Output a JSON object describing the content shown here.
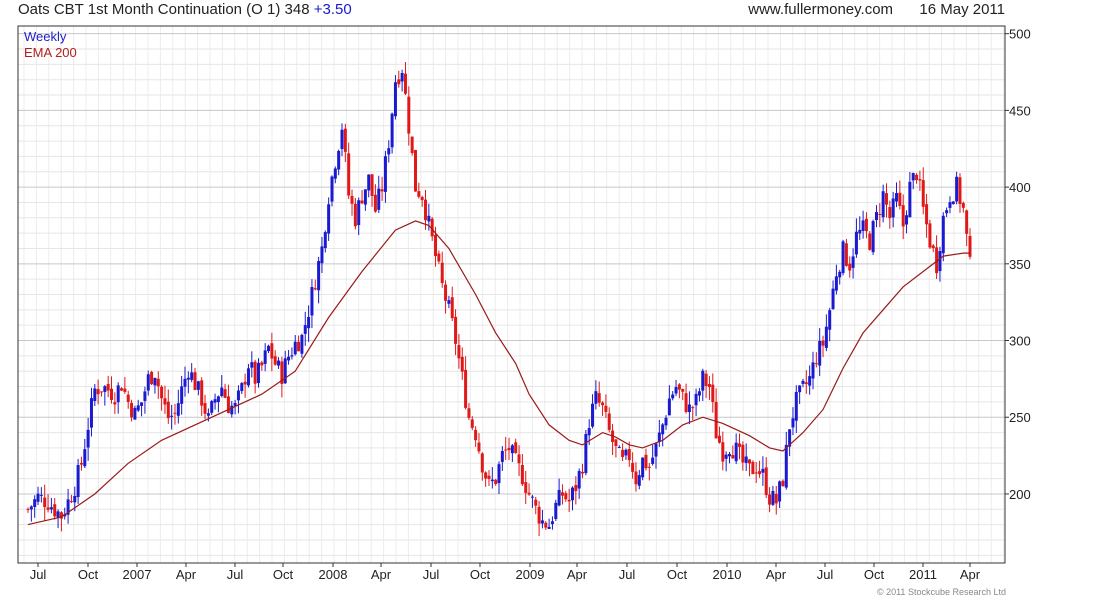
{
  "header": {
    "title": "Oats CBT 1st Month Continuation (O 1)",
    "last": "348",
    "change": "+3.50",
    "website": "www.fullermoney.com",
    "date": "16 May 2011"
  },
  "footer": {
    "copyright": "© 2011 Stockcube Research Ltd"
  },
  "colors": {
    "up": "#1a1ad0",
    "down": "#e01818",
    "ema": "#9a1a1a",
    "grid": "#d4d4d4",
    "frame": "#333333"
  },
  "chart_data": {
    "type": "candlestick",
    "title": "Oats CBT 1st Month Continuation (O 1)",
    "frequency": "Weekly",
    "indicator": "EMA 200",
    "legend": [
      "Weekly",
      "EMA 200"
    ],
    "legend_placement": "top-left",
    "y_axis_position": "right",
    "ylim": [
      155,
      505
    ],
    "yticks": [
      200,
      250,
      300,
      350,
      400,
      450,
      500
    ],
    "x_labels": [
      "Jul",
      "Oct",
      "2007",
      "Apr",
      "Jul",
      "Oct",
      "2008",
      "Apr",
      "Jul",
      "Oct",
      "2009",
      "Apr",
      "Jul",
      "Oct",
      "2010",
      "Apr",
      "Jul",
      "Oct",
      "2011",
      "Apr"
    ],
    "grid": true,
    "close_series": {
      "name": "Weekly",
      "points": [
        [
          0,
          190
        ],
        [
          3,
          198
        ],
        [
          6,
          195
        ],
        [
          8,
          190
        ],
        [
          10,
          186
        ],
        [
          12,
          195
        ],
        [
          14,
          205
        ],
        [
          16,
          220
        ],
        [
          18,
          245
        ],
        [
          20,
          268
        ],
        [
          22,
          270
        ],
        [
          24,
          268
        ],
        [
          26,
          265
        ],
        [
          28,
          272
        ],
        [
          30,
          260
        ],
        [
          32,
          252
        ],
        [
          34,
          260
        ],
        [
          36,
          275
        ],
        [
          38,
          280
        ],
        [
          40,
          262
        ],
        [
          42,
          250
        ],
        [
          44,
          252
        ],
        [
          46,
          268
        ],
        [
          48,
          282
        ],
        [
          50,
          272
        ],
        [
          52,
          262
        ],
        [
          54,
          248
        ],
        [
          56,
          262
        ],
        [
          58,
          270
        ],
        [
          60,
          258
        ],
        [
          62,
          256
        ],
        [
          64,
          268
        ],
        [
          66,
          285
        ],
        [
          68,
          275
        ],
        [
          70,
          283
        ],
        [
          72,
          295
        ],
        [
          74,
          285
        ],
        [
          76,
          278
        ],
        [
          78,
          290
        ],
        [
          80,
          298
        ],
        [
          82,
          302
        ],
        [
          84,
          320
        ],
        [
          86,
          340
        ],
        [
          88,
          360
        ],
        [
          90,
          395
        ],
        [
          92,
          418
        ],
        [
          94,
          440
        ],
        [
          96,
          395
        ],
        [
          98,
          380
        ],
        [
          100,
          395
        ],
        [
          102,
          405
        ],
        [
          104,
          385
        ],
        [
          106,
          400
        ],
        [
          108,
          430
        ],
        [
          110,
          470
        ],
        [
          112,
          478
        ],
        [
          114,
          440
        ],
        [
          116,
          400
        ],
        [
          118,
          395
        ],
        [
          120,
          375
        ],
        [
          122,
          355
        ],
        [
          124,
          335
        ],
        [
          126,
          320
        ],
        [
          128,
          300
        ],
        [
          130,
          275
        ],
        [
          132,
          250
        ],
        [
          134,
          240
        ],
        [
          136,
          220
        ],
        [
          138,
          205
        ],
        [
          140,
          210
        ],
        [
          142,
          225
        ],
        [
          144,
          230
        ],
        [
          146,
          220
        ],
        [
          148,
          212
        ],
        [
          150,
          200
        ],
        [
          152,
          190
        ],
        [
          154,
          182
        ],
        [
          156,
          180
        ],
        [
          158,
          192
        ],
        [
          160,
          200
        ],
        [
          162,
          195
        ],
        [
          164,
          205
        ],
        [
          166,
          220
        ],
        [
          168,
          248
        ],
        [
          170,
          262
        ],
        [
          172,
          255
        ],
        [
          174,
          240
        ],
        [
          176,
          228
        ],
        [
          178,
          220
        ],
        [
          180,
          225
        ],
        [
          182,
          210
        ],
        [
          184,
          222
        ],
        [
          186,
          218
        ],
        [
          188,
          230
        ],
        [
          190,
          245
        ],
        [
          192,
          262
        ],
        [
          194,
          270
        ],
        [
          196,
          262
        ],
        [
          198,
          255
        ],
        [
          200,
          260
        ],
        [
          202,
          275
        ],
        [
          204,
          270
        ],
        [
          206,
          240
        ],
        [
          208,
          228
        ],
        [
          210,
          232
        ],
        [
          212,
          228
        ],
        [
          214,
          220
        ],
        [
          216,
          215
        ],
        [
          218,
          218
        ],
        [
          220,
          212
        ],
        [
          222,
          198
        ],
        [
          224,
          195
        ],
        [
          226,
          210
        ],
        [
          228,
          245
        ],
        [
          230,
          260
        ],
        [
          232,
          268
        ],
        [
          234,
          275
        ],
        [
          236,
          290
        ],
        [
          238,
          298
        ],
        [
          240,
          320
        ],
        [
          242,
          345
        ],
        [
          244,
          358
        ],
        [
          246,
          350
        ],
        [
          248,
          368
        ],
        [
          250,
          372
        ],
        [
          252,
          365
        ],
        [
          254,
          380
        ],
        [
          256,
          395
        ],
        [
          258,
          380
        ],
        [
          260,
          392
        ],
        [
          262,
          375
        ],
        [
          264,
          400
        ],
        [
          266,
          410
        ],
        [
          268,
          385
        ],
        [
          270,
          365
        ],
        [
          272,
          350
        ],
        [
          274,
          380
        ],
        [
          276,
          395
        ],
        [
          278,
          400
        ],
        [
          280,
          385
        ],
        [
          282,
          348
        ]
      ]
    },
    "ema_series": {
      "name": "EMA 200",
      "points": [
        [
          0,
          180
        ],
        [
          10,
          185
        ],
        [
          20,
          200
        ],
        [
          30,
          220
        ],
        [
          40,
          235
        ],
        [
          50,
          245
        ],
        [
          60,
          255
        ],
        [
          70,
          265
        ],
        [
          80,
          280
        ],
        [
          90,
          315
        ],
        [
          100,
          345
        ],
        [
          110,
          372
        ],
        [
          116,
          378
        ],
        [
          120,
          375
        ],
        [
          126,
          360
        ],
        [
          134,
          330
        ],
        [
          140,
          305
        ],
        [
          146,
          285
        ],
        [
          150,
          265
        ],
        [
          156,
          245
        ],
        [
          162,
          235
        ],
        [
          166,
          232
        ],
        [
          172,
          240
        ],
        [
          176,
          237
        ],
        [
          180,
          232
        ],
        [
          184,
          230
        ],
        [
          190,
          235
        ],
        [
          196,
          245
        ],
        [
          202,
          250
        ],
        [
          208,
          246
        ],
        [
          216,
          238
        ],
        [
          222,
          230
        ],
        [
          226,
          228
        ],
        [
          232,
          240
        ],
        [
          238,
          255
        ],
        [
          244,
          282
        ],
        [
          250,
          305
        ],
        [
          256,
          320
        ],
        [
          262,
          335
        ],
        [
          268,
          345
        ],
        [
          274,
          355
        ],
        [
          280,
          357
        ],
        [
          282,
          357
        ]
      ]
    }
  }
}
